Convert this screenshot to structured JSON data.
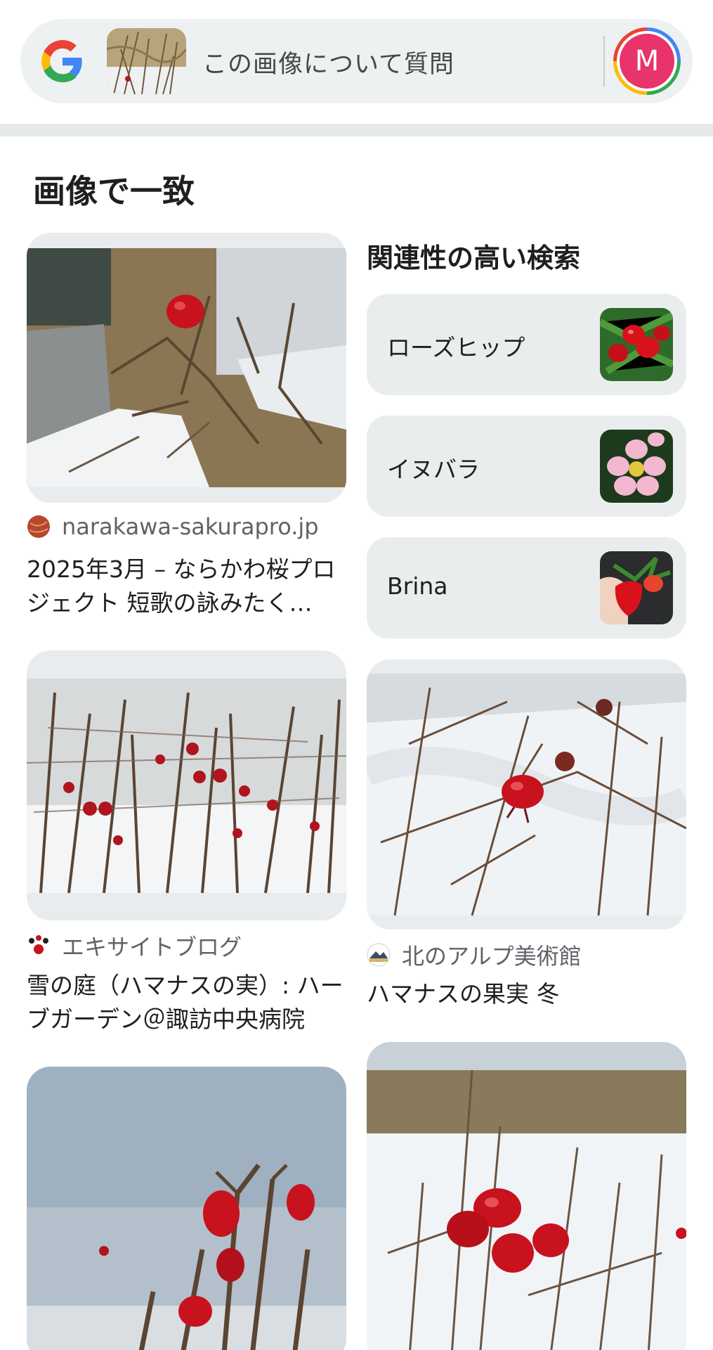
{
  "search_bar": {
    "logo": "google-g-icon",
    "prompt": "この画像について質問",
    "avatar_initial": "M"
  },
  "section_title": "画像で一致",
  "related": {
    "heading": "関連性の高い検索",
    "items": [
      {
        "label": "ローズヒップ",
        "thumb": "rosehip-thumbnail"
      },
      {
        "label": "イヌバラ",
        "thumb": "dog-rose-thumbnail"
      },
      {
        "label": "Brina",
        "thumb": "strawberry-thumbnail"
      }
    ]
  },
  "results": [
    {
      "source": "narakawa-sakurapro.jp",
      "title": "2025年3月 – ならかわ桜プロジェクト 短歌の詠みたく…"
    },
    {
      "source": "エキサイトブログ",
      "title": "雪の庭（ハマナスの実）: ハーブガーデン＠諏訪中央病院"
    },
    {
      "source": "北のアルプ美術館",
      "title": "ハマナスの果実 冬"
    }
  ],
  "colors": {
    "search_bg": "#eef1f2",
    "avatar_bg": "#e8336b",
    "card_bg": "#eaedee",
    "berry_red": "#c8121e",
    "snow": "#f4f6f8"
  }
}
